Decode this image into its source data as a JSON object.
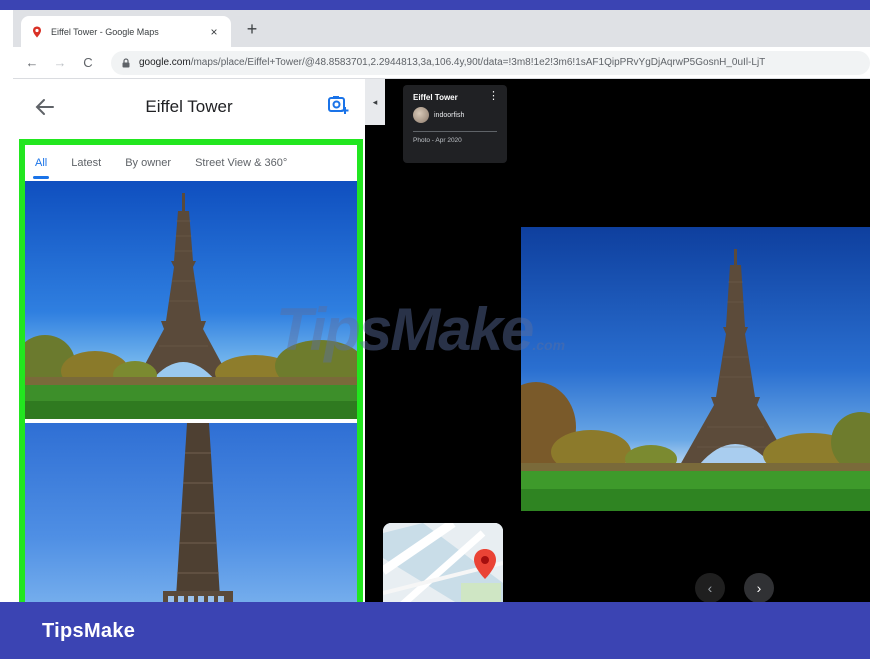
{
  "browser": {
    "tab_title": "Eiffel Tower - Google Maps",
    "tab_close": "×",
    "new_tab": "+",
    "back": "←",
    "forward": "→",
    "reload": "C",
    "url_domain": "google.com",
    "url_path": "/maps/place/Eiffel+Tower/@48.8583701,2.2944813,3a,106.4y,90t/data=!3m8!1e2!3m6!1sAF1QipPRvYgDjAqrwP5GosnH_0uIl-LjT"
  },
  "panel": {
    "title": "Eiffel Tower",
    "tabs": [
      {
        "label": "All",
        "active": true
      },
      {
        "label": "Latest",
        "active": false
      },
      {
        "label": "By owner",
        "active": false
      },
      {
        "label": "Street View & 360°",
        "active": false
      }
    ],
    "collapse_label": "◂"
  },
  "photo_info": {
    "title": "Eiffel Tower",
    "more": "⋮",
    "username": "indoorfish",
    "date": "Photo - Apr 2020"
  },
  "navigation": {
    "prev": "‹",
    "next": "›"
  },
  "watermark": {
    "text": "TipsMake",
    "suffix": ".com"
  },
  "brand": {
    "name": "TipsMake"
  },
  "colors": {
    "frame": "#3b44b3",
    "highlight": "#22e61f",
    "active_tab": "#1a73e8"
  },
  "icons": {
    "back": "arrow-left-icon",
    "add_photo": "add-photo-icon",
    "lock": "lock-icon",
    "favicon": "map-pin-icon",
    "map_pin": "map-marker-icon"
  }
}
